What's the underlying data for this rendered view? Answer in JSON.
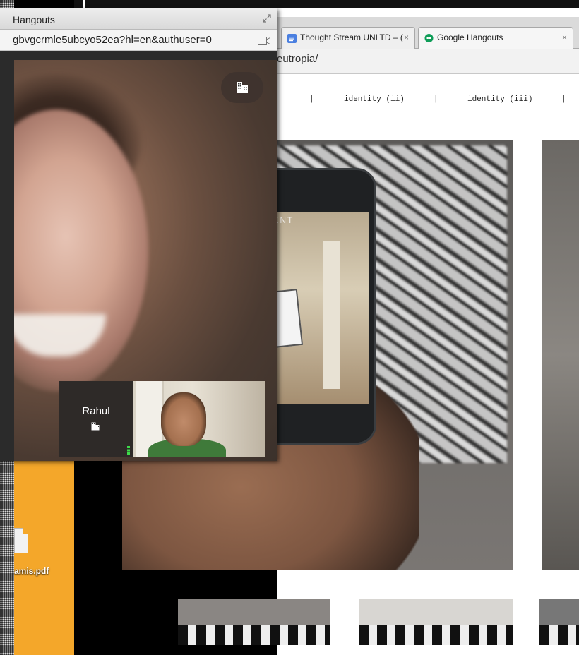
{
  "desktop": {
    "file_label": "amis.pdf"
  },
  "browser": {
    "tabs": [
      {
        "label": "Thought Stream UNLTD – (",
        "close": "×",
        "icon": "docs-icon",
        "color": "#4a7fe0"
      },
      {
        "label": "Google Hangouts",
        "close": "×",
        "icon": "hangouts-icon",
        "color": "#0f9d58"
      }
    ],
    "address": "eutropia/",
    "nav": {
      "sep1": "|",
      "link1": "identity (ii)",
      "sep2": "|",
      "link2": "identity (iii)",
      "sep3": "|"
    },
    "photo_overlay_text": "GMENT"
  },
  "hangouts": {
    "title": "Hangouts",
    "url": "gbvgcrmle5ubcyo52ea?hl=en&authuser=0",
    "participant": {
      "name": "Rahul"
    }
  },
  "colors": {
    "accent_orange": "#f4a72a",
    "participant_shirt": "#3f7a3a"
  }
}
